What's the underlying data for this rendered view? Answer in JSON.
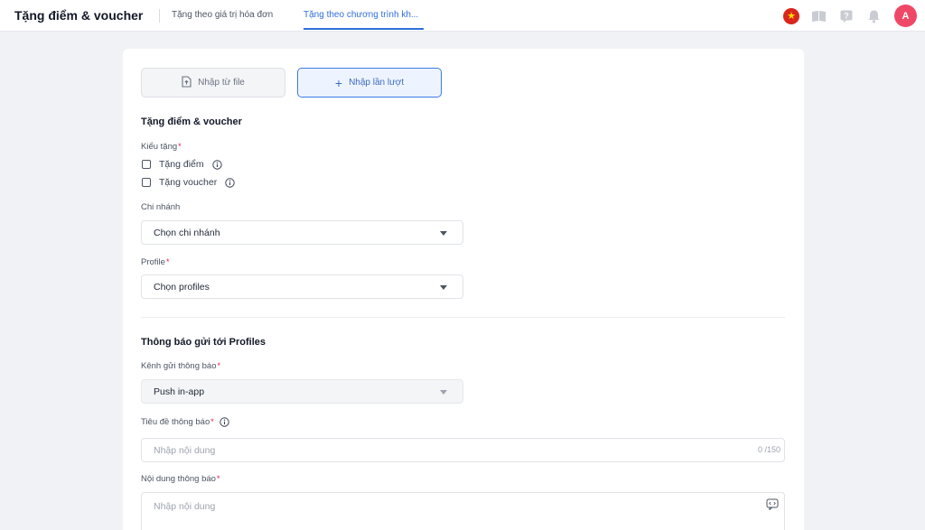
{
  "header": {
    "title": "Tặng điểm & voucher",
    "tabs": [
      {
        "label": "Tặng theo giá trị hóa đơn",
        "active": false
      },
      {
        "label": "Tặng theo chương trình kh...",
        "active": true
      }
    ],
    "icons": [
      "vietnam-flag-icon",
      "book-icon",
      "help-icon",
      "bell-icon"
    ],
    "avatar_letter": "A",
    "accent_color": "#2f6fdc",
    "avatar_color": "#ef4867"
  },
  "import_modes": {
    "from_file_label": "Nhập từ file",
    "manual_label": "Nhập lần lượt",
    "selected": "manual"
  },
  "gift_section": {
    "title": "Tặng điểm & voucher",
    "gift_type_label": "Kiểu tặng",
    "options": [
      {
        "label": "Tặng điểm",
        "checked": false
      },
      {
        "label": "Tặng voucher",
        "checked": false
      }
    ],
    "branch_label": "Chi nhánh",
    "branch_value": "Chọn chi nhánh",
    "profile_label": "Profile",
    "profile_value": "Chọn profiles"
  },
  "notification_section": {
    "title": "Thông báo gửi tới Profiles",
    "channel_label": "Kênh gửi thông báo",
    "channel_value": "Push in-app",
    "subject_label": "Tiêu đề thông báo",
    "subject_placeholder": "Nhập nội dung",
    "subject_counter": "0 /150",
    "content_label": "Nội dung thông báo",
    "content_placeholder": "Nhập nội dung"
  },
  "required_mark": "*"
}
